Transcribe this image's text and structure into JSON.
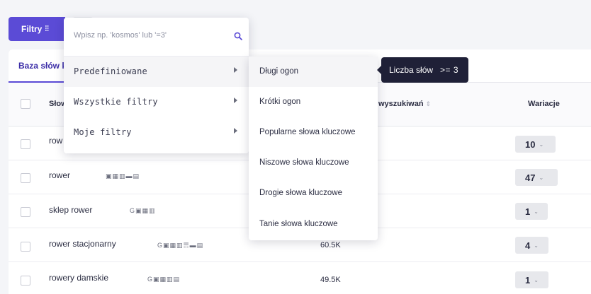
{
  "toolbar": {
    "filters_label": "Filtry"
  },
  "tabs": {
    "active_label": "Baza słów k"
  },
  "table": {
    "headers": {
      "keyword": "Słow",
      "searches": "wyszukiwań",
      "variations": "Wariacje"
    },
    "rows": [
      {
        "keyword": "row",
        "icons": "",
        "volume": "",
        "variations": "10"
      },
      {
        "keyword": "rower",
        "icons": "▣▦▥▬▤",
        "volume": "",
        "variations": "47"
      },
      {
        "keyword": "sklep rower",
        "icons": "G▣▦▥",
        "volume": "",
        "variations": "1"
      },
      {
        "keyword": "rower stacjonarny",
        "icons": "G▣▦▥☴▬▤",
        "volume": "60.5K",
        "variations": "4"
      },
      {
        "keyword": "rowery damskie",
        "icons": "G▣▦▥▤",
        "volume": "49.5K",
        "variations": "1"
      }
    ]
  },
  "filter_panel": {
    "search_placeholder": "Wpisz np. 'kosmos' lub '=3'",
    "items": [
      "Predefiniowane",
      "Wszystkie filtry",
      "Moje filtry"
    ]
  },
  "submenu": {
    "items": [
      "Długi ogon",
      "Krótki ogon",
      "Popularne słowa kluczowe",
      "Niszowe słowa kluczowe",
      "Drogie słowa kluczowe",
      "Tanie słowa kluczowe"
    ]
  },
  "tooltip": {
    "label": "Liczba słów",
    "operator": ">= 3"
  },
  "colors": {
    "accent": "#5b4bd6",
    "tooltip_bg": "#1f2037"
  }
}
